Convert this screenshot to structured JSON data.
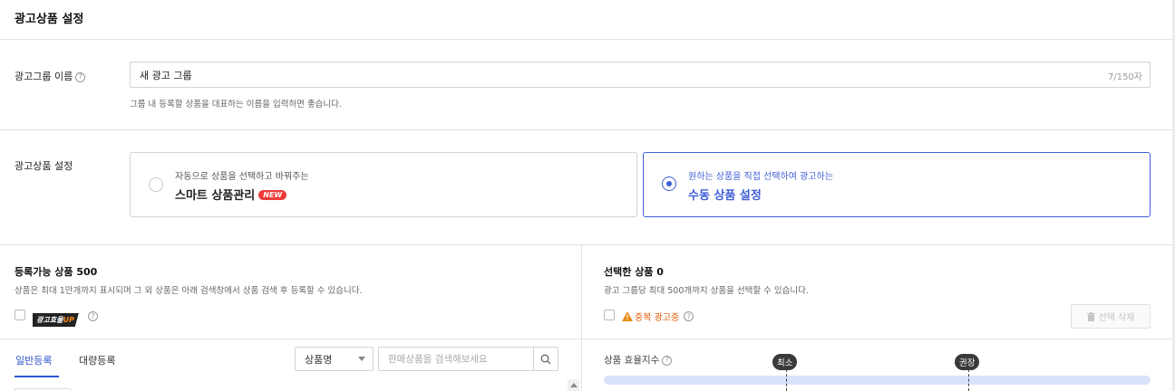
{
  "page": {
    "title": "광고상품 설정"
  },
  "group_name": {
    "label": "광고그룹 이름",
    "value": "새 광고 그룹",
    "counter": "7/150자",
    "hint": "그룹 내 등록할 상품을 대표하는 이름을 입력하면 좋습니다."
  },
  "product_setting": {
    "label": "광고상품 설정",
    "options": [
      {
        "sub": "자동으로 상품을 선택하고 바꿔주는",
        "main": "스마트 상품관리",
        "badge": "NEW",
        "selected": false
      },
      {
        "sub": "원하는 상품을 직접 선택하여 광고하는",
        "main": "수동 상품 설정",
        "selected": true
      }
    ]
  },
  "registrable": {
    "title": "등록가능 상품 500",
    "desc": "상품은 최대 1만개까지 표시되며 그 외 상품은 아래 검색창에서 상품 검색 후 등록할 수 있습니다.",
    "filter_badge": "광고효율",
    "filter_badge_up": "UP"
  },
  "selected": {
    "title": "선택한 상품 0",
    "desc": "광고 그룹당 최대 500개까지 상품을 선택할 수 있습니다.",
    "warning": "중복 광고중",
    "delete_button": "선택 삭제"
  },
  "tabs": [
    {
      "label": "일반등록",
      "active": true
    },
    {
      "label": "대량등록",
      "active": false
    }
  ],
  "search": {
    "select_value": "상품명",
    "placeholder": "판매상품을 검색해보세요"
  },
  "efficiency": {
    "label": "상품 효율지수",
    "markers": [
      "최소",
      "권장"
    ]
  },
  "colors": {
    "accent": "#3f5fd7",
    "new_badge": "#ee3a3a",
    "warning": "#e05a00"
  }
}
